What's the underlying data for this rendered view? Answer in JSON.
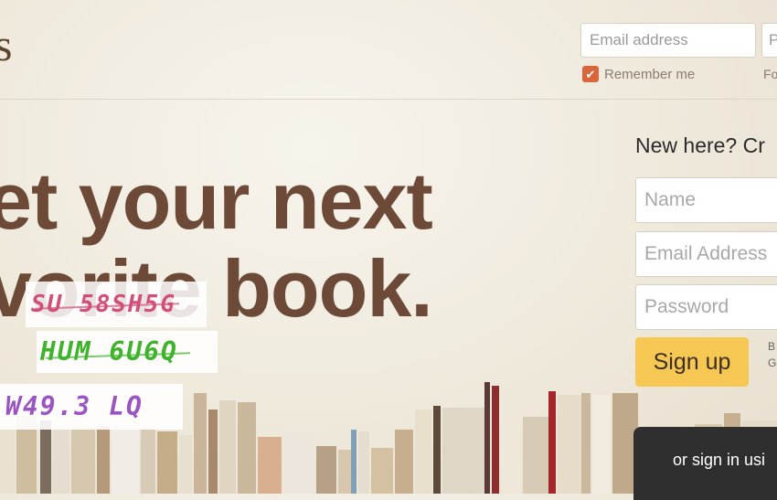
{
  "logo": {
    "text": "s"
  },
  "login": {
    "email_placeholder": "Email address",
    "password_placeholder": "P",
    "remember_label": "Remember me",
    "remember_checked": true,
    "forgot_label": "Fo"
  },
  "hero": {
    "line1": "et your next",
    "line2": "vorite book."
  },
  "signup": {
    "heading": "New here? Cr",
    "name_placeholder": "Name",
    "email_placeholder": "Email Address",
    "password_placeholder": "Password",
    "button_label": "Sign up",
    "fine_print": "B G c"
  },
  "captchas": [
    "SU 58SH5G",
    "HUM 6U6Q",
    "W49.3 LQ"
  ],
  "social": {
    "label": "or sign in usi"
  },
  "colors": {
    "headline": "#6d4a37",
    "signup_button": "#f6c752",
    "checkbox": "#d9653b",
    "social_bar": "#2f2f2f"
  }
}
